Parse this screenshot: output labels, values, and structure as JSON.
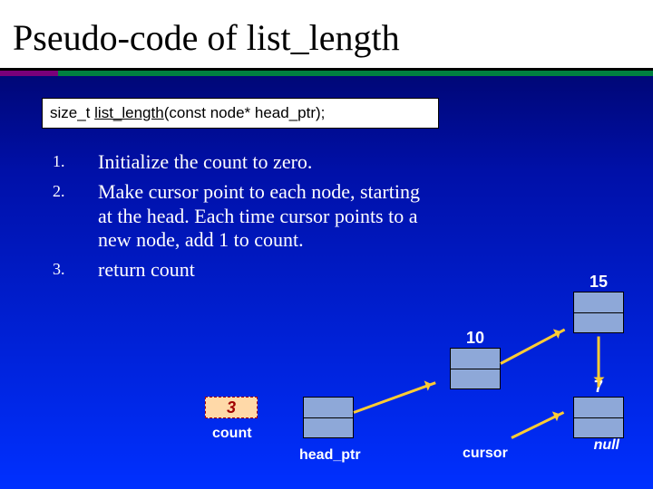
{
  "title": "Pseudo-code of list_length",
  "signature": {
    "ret": "size_t ",
    "fn": "list_length",
    "args": "(const node* head_ptr);"
  },
  "steps": [
    "Initialize the count to zero.",
    "Make cursor point to each node, starting at the head. Each time cursor points to a new node, add 1 to count.",
    "return count"
  ],
  "count_value": "3",
  "labels": {
    "count": "count",
    "head_ptr": "head_ptr",
    "cursor": "cursor"
  },
  "nodes": {
    "n2": "10",
    "n3": "15",
    "n4": "7",
    "null": "null"
  }
}
